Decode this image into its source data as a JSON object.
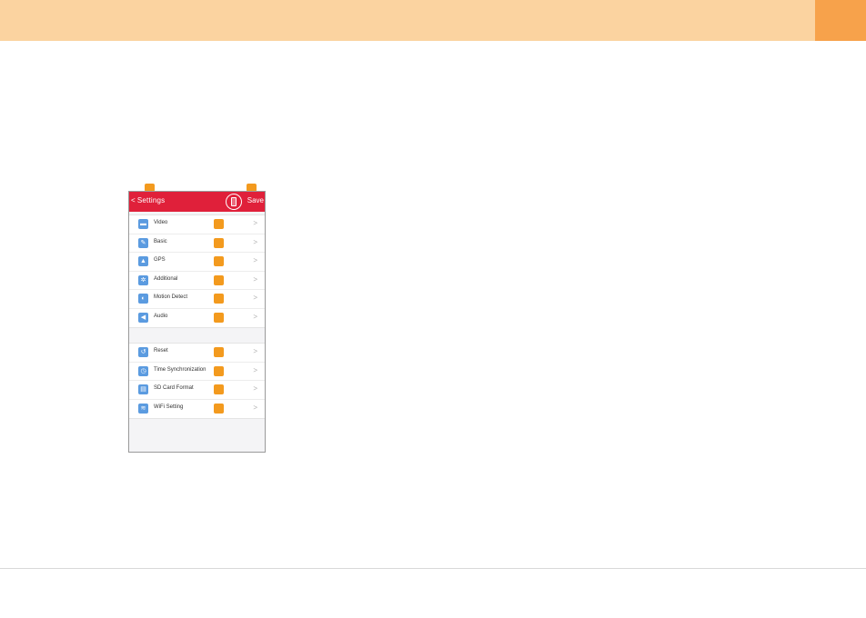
{
  "phone": {
    "navbar": {
      "back_label": "Settings",
      "back_chevron": "<",
      "device_icon": "phone-device-icon",
      "save_label": "Save",
      "color": "#e0203a"
    },
    "sections": [
      {
        "items": [
          {
            "label": "Video",
            "icon": "video-icon",
            "glyph": "▬"
          },
          {
            "label": "Basic",
            "icon": "basic-icon",
            "glyph": "✎"
          },
          {
            "label": "GPS",
            "icon": "gps-icon",
            "glyph": "▲"
          },
          {
            "label": "Additional",
            "icon": "additional-icon",
            "glyph": "✲"
          },
          {
            "label": "Motion Detect",
            "icon": "motion-detect-icon",
            "glyph": "◐"
          },
          {
            "label": "Audio",
            "icon": "audio-icon",
            "glyph": "◀"
          }
        ]
      },
      {
        "items": [
          {
            "label": "Reset",
            "icon": "reset-icon",
            "glyph": "↺"
          },
          {
            "label": "Time Synchronization",
            "icon": "clock-icon",
            "glyph": "◷"
          },
          {
            "label": "SD Card Format",
            "icon": "sd-card-icon",
            "glyph": "▤"
          },
          {
            "label": "WiFi Setting",
            "icon": "wifi-icon",
            "glyph": "≋"
          }
        ]
      }
    ],
    "row_chevron": ">"
  },
  "colors": {
    "header_band": "#fbd3a0",
    "header_tab": "#f7a24b",
    "marker": "#f39a1e"
  }
}
